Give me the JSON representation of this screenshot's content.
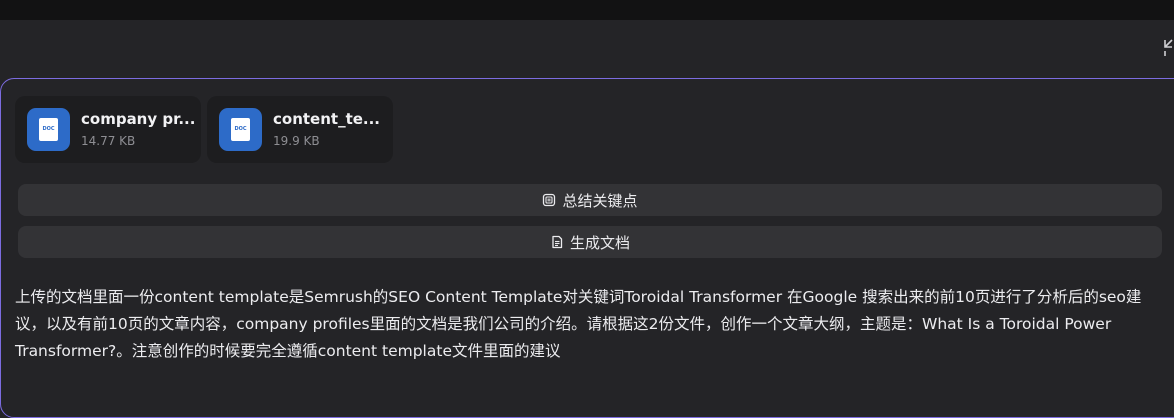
{
  "attachments": [
    {
      "name": "company pr...",
      "size": "14.77 KB",
      "type_tag": "DOC",
      "icon": "word-doc-icon"
    },
    {
      "name": "content_te...",
      "size": "19.9 KB",
      "type_tag": "DOC",
      "icon": "word-doc-icon"
    }
  ],
  "actions": [
    {
      "label": "总结关键点",
      "icon": "summary-icon"
    },
    {
      "label": "生成文档",
      "icon": "document-icon"
    }
  ],
  "prompt_text": "上传的文档里面一份content template是Semrush的SEO Content Template对关键词Toroidal Transformer 在Google 搜索出来的前10页进行了分析后的seo建议，以及有前10页的文章内容，company profiles里面的文档是我们公司的介绍。请根据这2份文件，创作一个文章大纲，主题是：What Is a Toroidal Power Transformer?。注意创作的时候要完全遵循content template文件里面的建议",
  "colors": {
    "background": "#242427",
    "panel_border": "#7c6ce0",
    "doc_icon": "#2d6bc8",
    "button_bg": "#333336"
  },
  "top_right_icon": "collapse-icon"
}
